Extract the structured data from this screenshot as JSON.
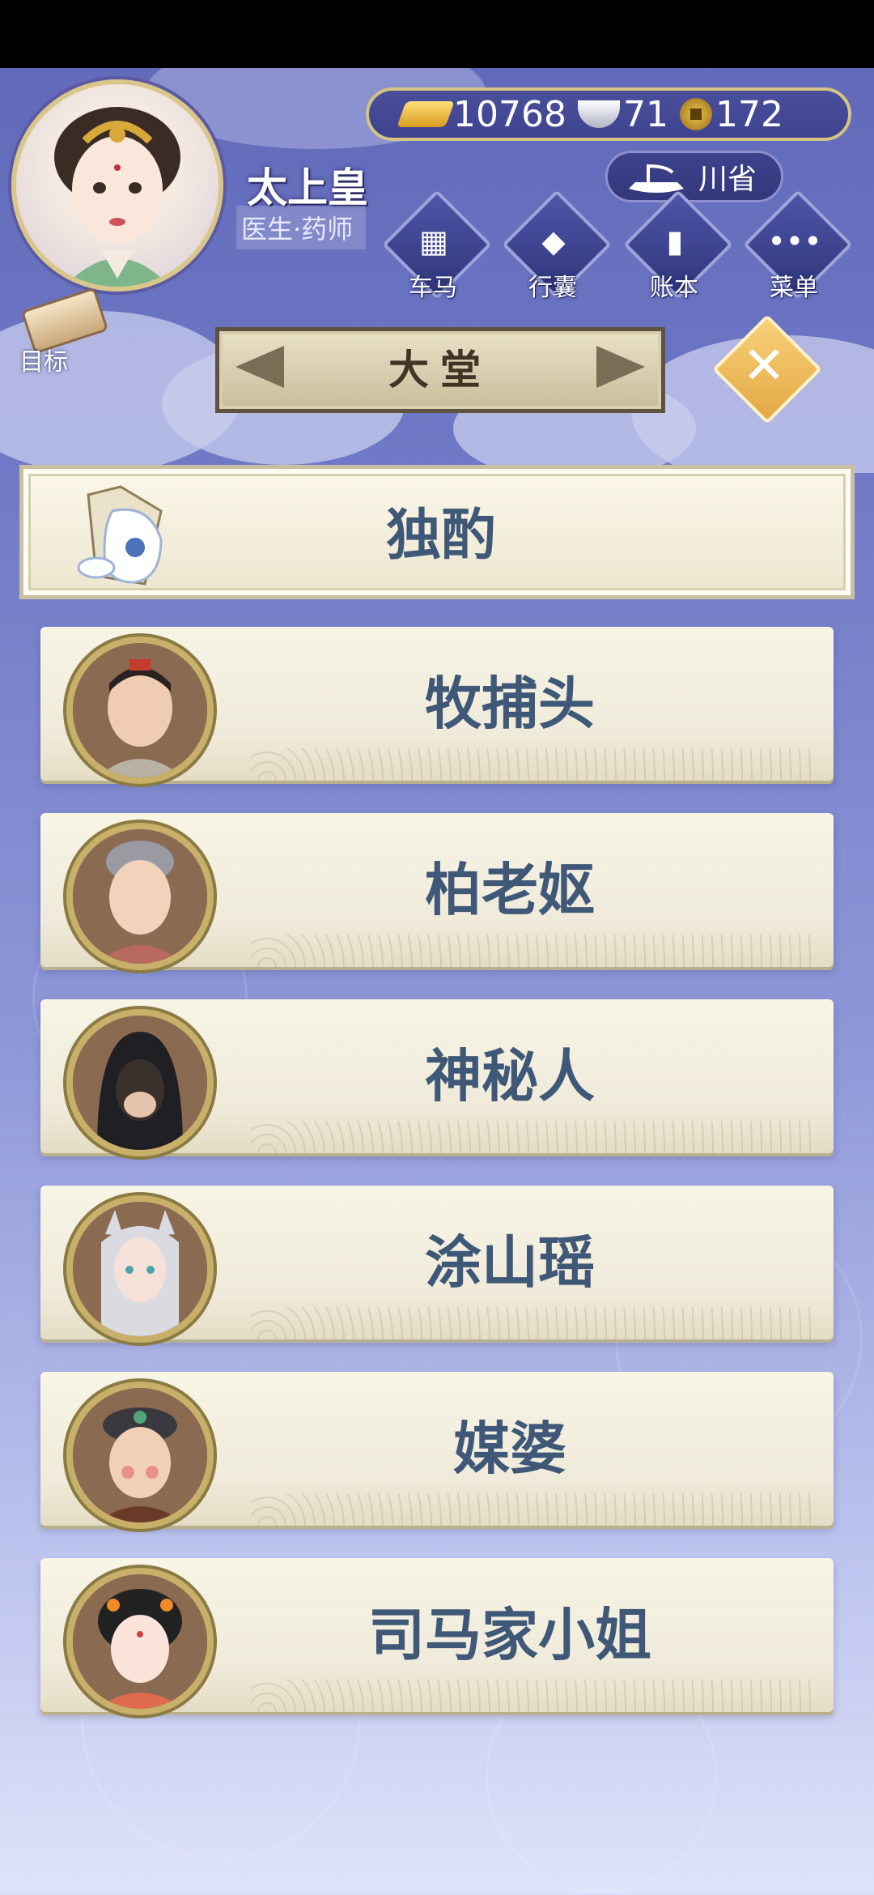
{
  "player": {
    "name": "太上皇",
    "role": "医生·药师"
  },
  "currency": {
    "gold": "10768",
    "silver": "71",
    "coin": "172"
  },
  "region": {
    "label": "川省"
  },
  "menu": [
    {
      "label": "车马",
      "icon": "carriage-icon"
    },
    {
      "label": "行囊",
      "icon": "bag-icon"
    },
    {
      "label": "账本",
      "icon": "ledger-icon"
    },
    {
      "label": "菜单",
      "icon": "more-icon"
    }
  ],
  "goal": {
    "label": "目标"
  },
  "hall": {
    "title": "大堂"
  },
  "drink": {
    "label": "独酌"
  },
  "npcs": [
    {
      "name": "牧捕头"
    },
    {
      "name": "柏老妪"
    },
    {
      "name": "神秘人"
    },
    {
      "name": "涂山瑶"
    },
    {
      "name": "媒婆"
    },
    {
      "name": "司马家小姐"
    }
  ],
  "colors": {
    "background": "#6f79c6",
    "accent": "#d6c384",
    "name_text": "#3f5878"
  }
}
